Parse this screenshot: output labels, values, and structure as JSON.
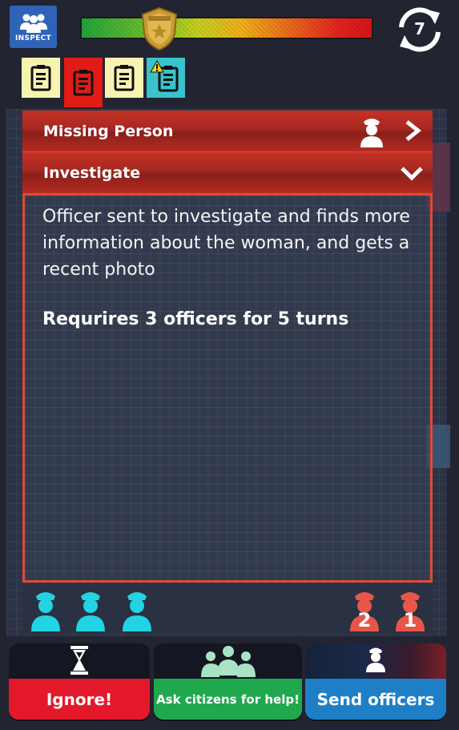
{
  "app": {
    "logo_text": "INSPECT"
  },
  "turns": {
    "count": "7"
  },
  "case_tabs": [
    {
      "color": "#f6f4b0",
      "icon": "clipboard-icon",
      "state": "normal"
    },
    {
      "color": "#e11b16",
      "icon": "clipboard-icon",
      "state": "active"
    },
    {
      "color": "#f6f4b0",
      "icon": "clipboard-icon",
      "state": "normal"
    },
    {
      "color": "#38c3cd",
      "icon": "clipboard-icon",
      "state": "warning"
    }
  ],
  "case": {
    "title": "Missing Person",
    "action": "Investigate",
    "description": "Officer sent to investigate and finds more information about the woman, and gets a recent photo",
    "requirement": "Requrires 3 officers for 5 turns"
  },
  "officers": {
    "available_color": "#22d3e3",
    "busy_color": "#e8564a",
    "busy": [
      {
        "turns_left": "2"
      },
      {
        "turns_left": "1"
      }
    ]
  },
  "buttons": {
    "ignore": {
      "label": "Ignore!",
      "color": "#e3192b"
    },
    "ask": {
      "label": "Ask citizens for help!",
      "color": "#1fa84d"
    },
    "send": {
      "label": "Send officers",
      "color": "#1e7fc7"
    }
  }
}
